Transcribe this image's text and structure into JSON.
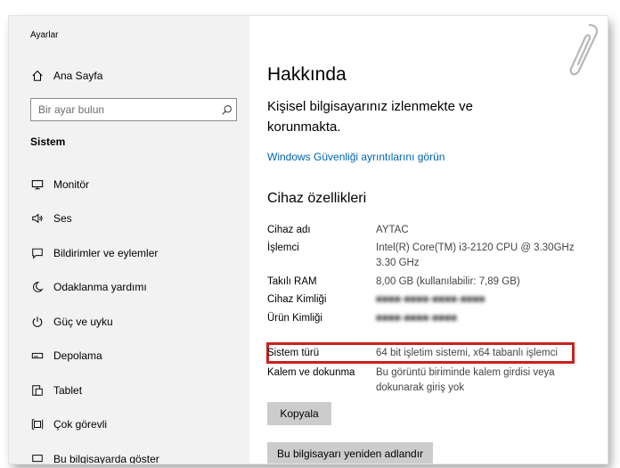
{
  "window": {
    "title": "Ayarlar"
  },
  "sidebar": {
    "home_label": "Ana Sayfa",
    "search_placeholder": "Bir ayar bulun",
    "section": "Sistem",
    "items": [
      {
        "label": "Monitör",
        "icon": "monitor-icon"
      },
      {
        "label": "Ses",
        "icon": "speaker-icon"
      },
      {
        "label": "Bildirimler ve eylemler",
        "icon": "notification-icon"
      },
      {
        "label": "Odaklanma yardımı",
        "icon": "moon-icon"
      },
      {
        "label": "Güç ve uyku",
        "icon": "power-icon"
      },
      {
        "label": "Depolama",
        "icon": "storage-icon"
      },
      {
        "label": "Tablet",
        "icon": "tablet-icon"
      },
      {
        "label": "Çok görevli",
        "icon": "multitasking-icon"
      },
      {
        "label": "Bu bilgisayarda göster",
        "icon": "project-icon"
      }
    ]
  },
  "main": {
    "title": "Hakkında",
    "security_text": "Kişisel bilgisayarınız izlenmekte ve korunmakta.",
    "security_link": "Windows Güvenliği ayrıntılarını görün",
    "device_specs_title": "Cihaz özellikleri",
    "specs": [
      {
        "key": "Cihaz adı",
        "value": "AYTAC"
      },
      {
        "key": "İşlemci",
        "value": "Intel(R) Core(TM) i3-2120 CPU @ 3.30GHz 3.30 GHz"
      },
      {
        "key": "Takılı RAM",
        "value": "8,00 GB (kullanılabilir: 7,89 GB)"
      },
      {
        "key": "Cihaz Kimliği",
        "value": ""
      },
      {
        "key": "Ürün Kimliği",
        "value": ""
      },
      {
        "key": "Sistem türü",
        "value": "64 bit işletim sistemi, x64 tabanlı işlemci"
      },
      {
        "key": "Kalem ve dokunma",
        "value": "Bu görüntü biriminde kalem girdisi veya dokunarak giriş yok"
      }
    ],
    "copy_button": "Kopyala",
    "rename_button": "Bu bilgisayarı yeniden adlandır"
  },
  "colors": {
    "accent_link": "#0063b1",
    "highlight": "#c9211e",
    "sidebar_bg": "#f2f2f2",
    "button_bg": "#cccccc"
  }
}
